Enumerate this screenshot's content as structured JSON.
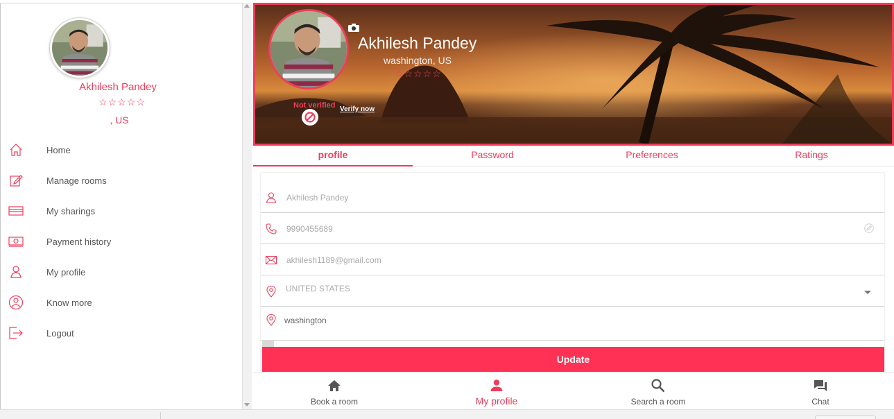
{
  "user": {
    "name": "Akhilesh Pandey",
    "sidebar_location": ", US",
    "banner_location": "washington, US",
    "stars": "☆☆☆☆☆"
  },
  "sidebar": {
    "items": [
      {
        "label": "Home",
        "icon": "home-icon"
      },
      {
        "label": "Manage rooms",
        "icon": "edit-icon"
      },
      {
        "label": "My sharings",
        "icon": "card-icon"
      },
      {
        "label": "Payment history",
        "icon": "money-icon"
      },
      {
        "label": "My profile",
        "icon": "person-icon"
      },
      {
        "label": "Know more",
        "icon": "info-person-icon"
      },
      {
        "label": "Logout",
        "icon": "logout-icon"
      }
    ]
  },
  "banner": {
    "verification_status": "Not verified",
    "verify_link": "Verify now"
  },
  "tabs": [
    {
      "label": "profile",
      "active": true
    },
    {
      "label": "Password",
      "active": false
    },
    {
      "label": "Preferences",
      "active": false
    },
    {
      "label": "Ratings",
      "active": false
    }
  ],
  "form": {
    "name": "Akhilesh Pandey",
    "phone": "9990455689",
    "email": "akhilesh1189@gmail.com",
    "country": "UNITED STATES",
    "city": "washington",
    "update_label": "Update"
  },
  "bottom_nav": [
    {
      "label": "Book a room",
      "icon": "home-icon",
      "active": false
    },
    {
      "label": "My profile",
      "icon": "person-icon",
      "active": true
    },
    {
      "label": "Search a room",
      "icon": "search-icon",
      "active": false
    },
    {
      "label": "Chat",
      "icon": "chat-icon",
      "active": false
    }
  ],
  "colors": {
    "accent": "#ef3d5b",
    "button": "#ff3155"
  }
}
